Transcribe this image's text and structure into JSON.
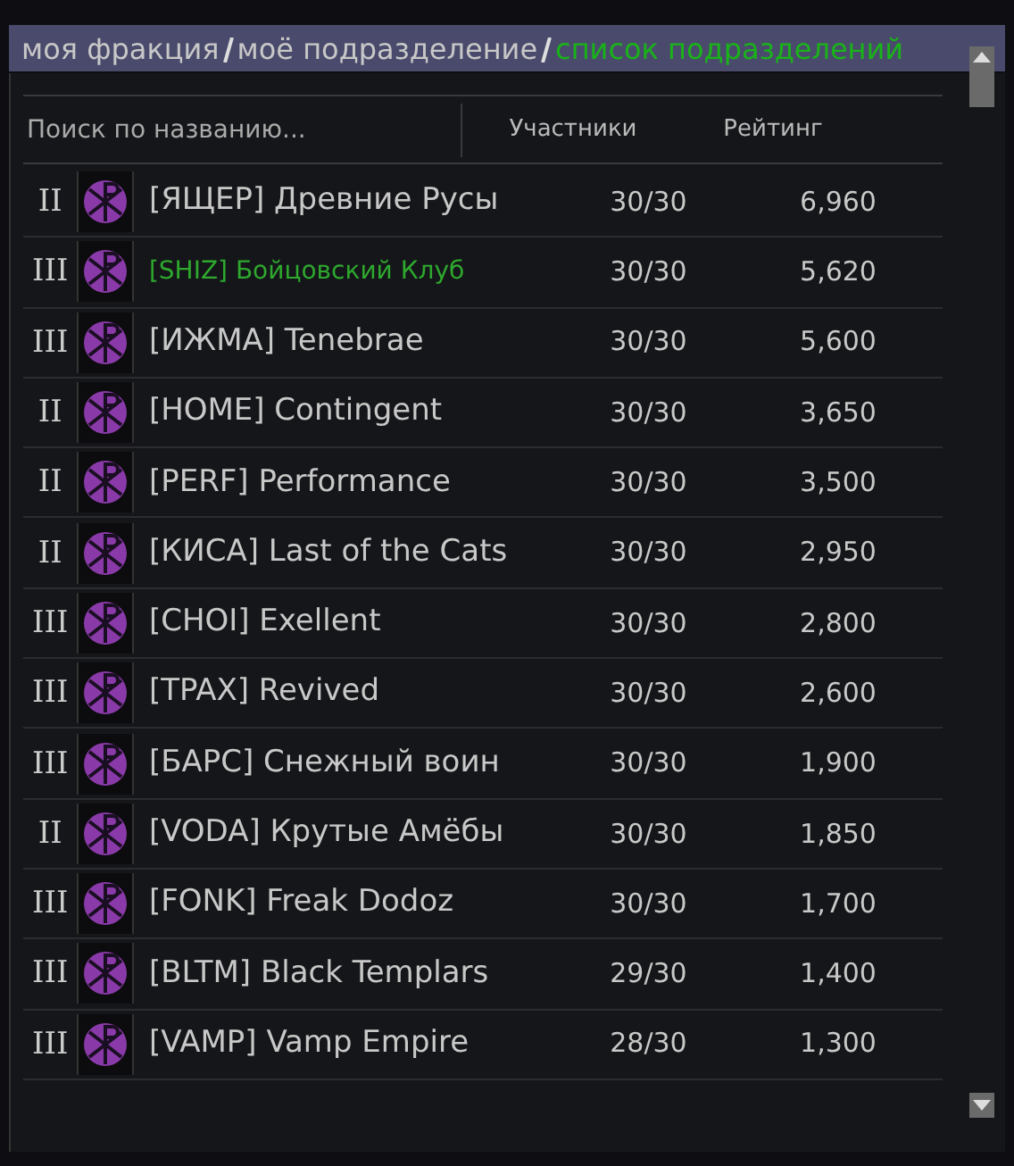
{
  "breadcrumbs": [
    {
      "label": "моя фракция",
      "current": false
    },
    {
      "label": "моё подразделение",
      "current": false
    },
    {
      "label": "список подразделений",
      "current": true
    }
  ],
  "search": {
    "placeholder": "Поиск по названию..."
  },
  "columns": [
    "Участники",
    "Рейтинг"
  ],
  "rows": [
    {
      "tier": "II",
      "name": "[ЯЩЕР] Древние Русы",
      "members": "30/30",
      "rating": "6,960",
      "own": false
    },
    {
      "tier": "III",
      "name": "[SHIZ] Бойцовский Клуб",
      "members": "30/30",
      "rating": "5,620",
      "own": true
    },
    {
      "tier": "III",
      "name": "[ИЖМА] Tenebrae",
      "members": "30/30",
      "rating": "5,600",
      "own": false
    },
    {
      "tier": "II",
      "name": "[HOME] Contingent",
      "members": "30/30",
      "rating": "3,650",
      "own": false
    },
    {
      "tier": "II",
      "name": "[PERF] Performance",
      "members": "30/30",
      "rating": "3,500",
      "own": false
    },
    {
      "tier": "II",
      "name": "[КИСА] Last of the Cats",
      "members": "30/30",
      "rating": "2,950",
      "own": false
    },
    {
      "tier": "III",
      "name": "[CHOI] Exellent",
      "members": "30/30",
      "rating": "2,800",
      "own": false
    },
    {
      "tier": "III",
      "name": "[TPAX] Revived",
      "members": "30/30",
      "rating": "2,600",
      "own": false
    },
    {
      "tier": "III",
      "name": "[БАРС] Снежный воин",
      "members": "30/30",
      "rating": "1,900",
      "own": false
    },
    {
      "tier": "II",
      "name": "[VODA] Крутые Амёбы",
      "members": "30/30",
      "rating": "1,850",
      "own": false
    },
    {
      "tier": "III",
      "name": "[FONK] Freak Dodoz",
      "members": "30/30",
      "rating": "1,700",
      "own": false
    },
    {
      "tier": "III",
      "name": "[BLTM] Black Templars",
      "members": "29/30",
      "rating": "1,400",
      "own": false
    },
    {
      "tier": "III",
      "name": "[VAMP] Vamp Empire",
      "members": "28/30",
      "rating": "1,300",
      "own": false
    }
  ]
}
